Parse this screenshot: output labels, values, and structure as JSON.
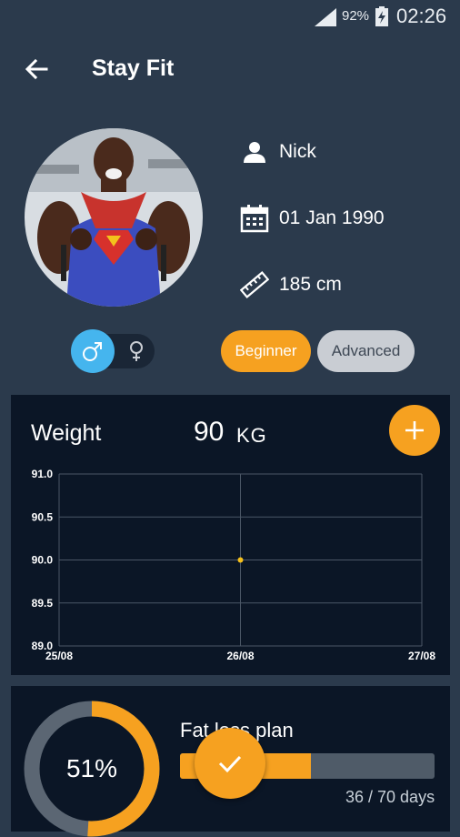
{
  "status_bar": {
    "battery_percent": "92%",
    "time": "02:26",
    "icons": [
      "signal-icon",
      "battery-charging-icon"
    ]
  },
  "app_bar": {
    "title": "Stay Fit",
    "back_icon": "arrow-left-icon"
  },
  "profile": {
    "avatar_icon": "profile-photo",
    "name": "Nick",
    "birth_date": "01 Jan 1990",
    "height": "185 cm",
    "icons": {
      "name": "person-icon",
      "birth_date": "calendar-icon",
      "height": "ruler-icon"
    },
    "gender": {
      "selected": "male",
      "male_icon": "male-symbol-icon",
      "female_icon": "female-symbol-icon"
    },
    "level_options": [
      "Beginner",
      "Advanced"
    ],
    "level_selected": "Beginner"
  },
  "weight_card": {
    "label": "Weight",
    "value": "90",
    "unit": "KG",
    "add_icon": "plus-icon"
  },
  "chart_data": {
    "type": "line",
    "x": [
      "25/08",
      "26/08",
      "27/08"
    ],
    "y_ticks": [
      "91.0",
      "90.5",
      "90.0",
      "89.5",
      "89.0"
    ],
    "ylim": [
      89.0,
      91.0
    ],
    "points": [
      {
        "x": "26/08",
        "y": 90.0
      }
    ],
    "grid": true
  },
  "plan_card": {
    "percent": "51%",
    "percent_value": 0.51,
    "title": "Fat loss plan",
    "days_text": "36 / 70 days",
    "progress_value": 0.514,
    "check_icon": "check-icon"
  },
  "colors": {
    "background": "#2b3a4c",
    "card": "#0b1626",
    "accent": "#f6a120",
    "male_blue": "#45b5ee",
    "pill_inactive": "#c9cdd3"
  }
}
